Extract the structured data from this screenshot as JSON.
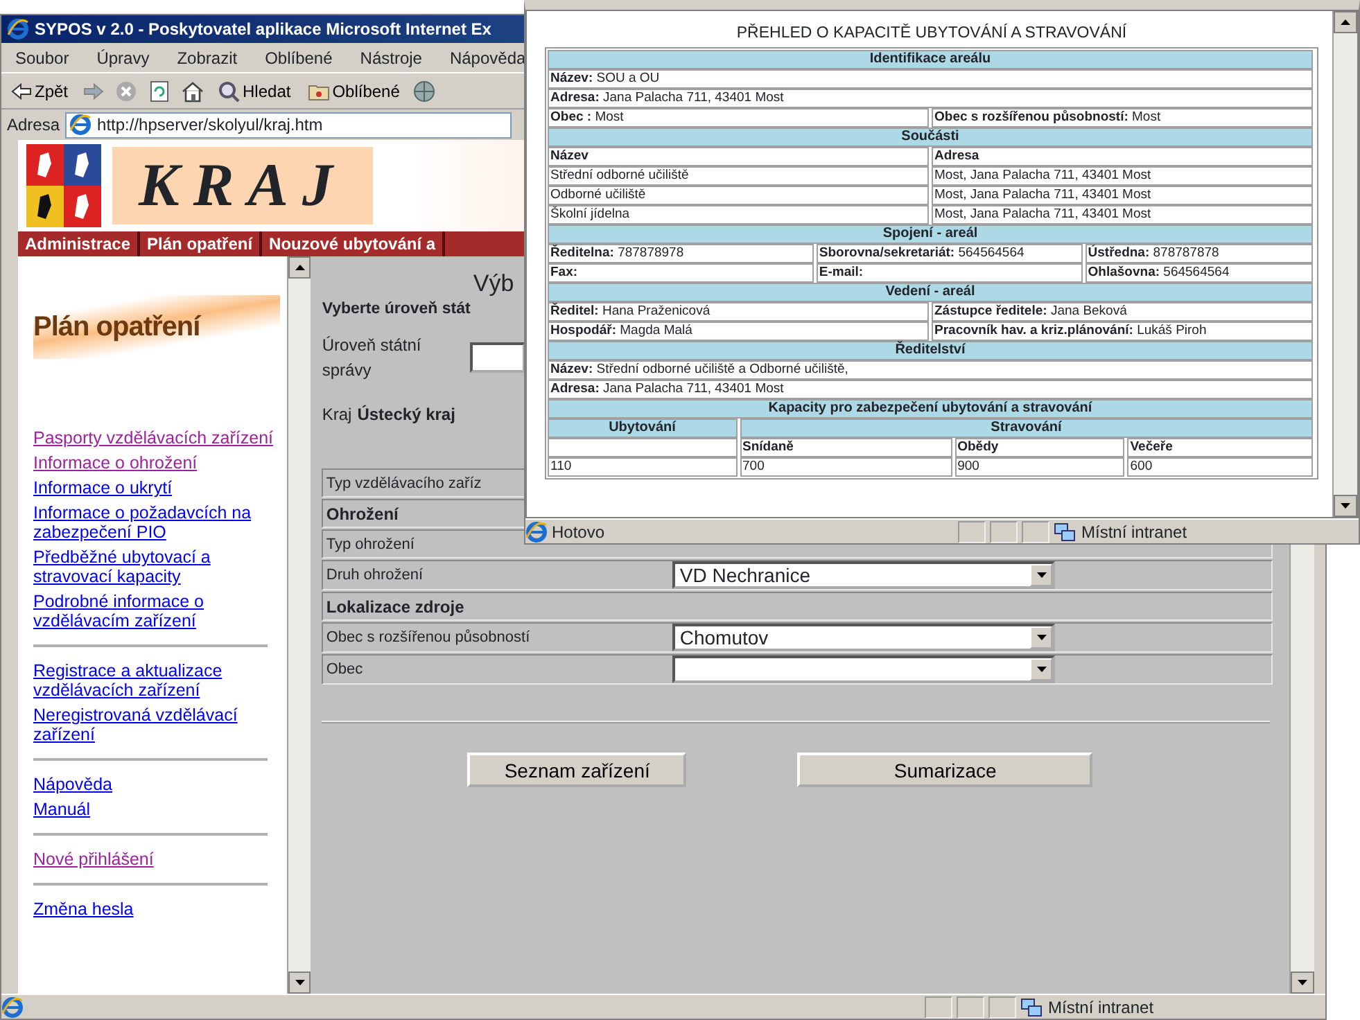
{
  "main_window": {
    "title": "SYPOS v 2.0 - Poskytovatel aplikace Microsoft Internet Ex",
    "menu": [
      "Soubor",
      "Úpravy",
      "Zobrazit",
      "Oblíbené",
      "Nástroje",
      "Nápověda"
    ],
    "toolbar": [
      {
        "kind": "back",
        "label": "Zpět"
      },
      {
        "kind": "forward"
      },
      {
        "kind": "stop"
      },
      {
        "kind": "refresh"
      },
      {
        "kind": "home"
      },
      {
        "kind": "search",
        "label": "Hledat"
      },
      {
        "kind": "favorites",
        "label": "Oblíbené"
      },
      {
        "kind": "media"
      }
    ],
    "address": {
      "label": "Adresa",
      "url": "http://hpserver/skolyul/kraj.htm"
    },
    "page": {
      "banner": {
        "title": "KRAJ"
      },
      "nav": [
        "Administrace",
        "Plán opatření",
        "Nouzové ubytování a"
      ],
      "sidebar": {
        "heading": "Plán opatření",
        "groups": [
          {
            "links": [
              {
                "label": "Pasporty vzdělávacích zařízení",
                "visited": true
              },
              {
                "label": "Informace o ohrožení",
                "visited": true
              },
              {
                "label": "Informace o ukrytí",
                "visited": false
              },
              {
                "label": "Informace o požadavcích na zabezpečení PIO",
                "visited": false
              },
              {
                "label": "Předběžné ubytovací a stravovací kapacity",
                "visited": false
              },
              {
                "label": "Podrobné informace o vzdělávacím zařízení",
                "visited": false
              }
            ]
          },
          {
            "links": [
              {
                "label": "Registrace a aktualizace vzdělávacích zařízení",
                "visited": false
              },
              {
                "label": "Neregistrovaná vzdělávací zařízení",
                "visited": false
              }
            ]
          },
          {
            "links": [
              {
                "label": "Nápověda",
                "visited": false
              },
              {
                "label": "Manuál",
                "visited": false
              }
            ]
          },
          {
            "links": [
              {
                "label": "Nové přihlášení",
                "visited": true
              }
            ]
          },
          {
            "links": [
              {
                "label": "Změna hesla",
                "visited": false
              }
            ]
          }
        ]
      },
      "form": {
        "heading": "Výb",
        "subheading": "Vyberte úroveň stát",
        "level_label": "Úroveň státní správy",
        "region_label": "Kraj",
        "region": "Ústecký kraj",
        "rows": [
          {
            "kind": "field",
            "label": "Typ vzdělávacího zaříz"
          },
          {
            "kind": "section",
            "label": "Ohrožení"
          },
          {
            "kind": "field",
            "label": "Typ ohrožení"
          },
          {
            "kind": "select",
            "label": "Druh ohrožení",
            "value": "VD Nechranice"
          },
          {
            "kind": "section",
            "label": "Lokalizace zdroje"
          },
          {
            "kind": "select",
            "label": "Obec s rozšířenou působností",
            "value": "Chomutov"
          },
          {
            "kind": "select",
            "label": "Obec"
          }
        ],
        "buttons": [
          "Seznam zařízení",
          "Sumarizace"
        ]
      }
    },
    "status_bar": {
      "zone": "Místní intranet"
    }
  },
  "popup": {
    "title": "PŘEHLED O KAPACITĚ UBYTOVÁNÍ A STRAVOVÁNÍ",
    "rows": [
      {
        "kind": "section",
        "cells": [
          {
            "label": "Identifikace areálu"
          }
        ]
      },
      {
        "kind": "cells",
        "cells": [
          {
            "label": "Název:",
            "value": "SOU a OU"
          }
        ]
      },
      {
        "kind": "cells",
        "cells": [
          {
            "label": "Adresa:",
            "value": "Jana Palacha 711, 43401 Most"
          }
        ]
      },
      {
        "kind": "cells",
        "cells": [
          {
            "label": "Obec :",
            "value": "Most"
          },
          {
            "label": "Obec s rozšířenou působností:",
            "value": "Most"
          }
        ]
      },
      {
        "kind": "section",
        "cells": [
          {
            "label": "Součásti"
          }
        ]
      },
      {
        "kind": "cells",
        "cells": [
          {
            "label": "Název"
          },
          {
            "label": "Adresa"
          }
        ]
      },
      {
        "kind": "cells",
        "cells": [
          {
            "value": "Střední odborné učiliště"
          },
          {
            "value": "Most, Jana Palacha 711, 43401 Most"
          }
        ]
      },
      {
        "kind": "cells",
        "cells": [
          {
            "value": "Odborné učiliště"
          },
          {
            "value": "Most, Jana Palacha 711, 43401 Most"
          }
        ]
      },
      {
        "kind": "cells",
        "cells": [
          {
            "value": "Školní jídelna"
          },
          {
            "value": "Most, Jana Palacha 711, 43401 Most"
          }
        ]
      },
      {
        "kind": "section",
        "cells": [
          {
            "label": "Spojení - areál"
          }
        ]
      },
      {
        "kind": "cells",
        "cells": [
          {
            "label": "Ředitelna:",
            "value": "787878978"
          },
          {
            "label": "Sborovna/sekretariát:",
            "value": "564564564"
          },
          {
            "label": "Ústředna:",
            "value": "878787878"
          }
        ]
      },
      {
        "kind": "cells",
        "cells": [
          {
            "label": "Fax:"
          },
          {
            "label": "E-mail:"
          },
          {
            "label": "Ohlašovna:",
            "value": "564564564"
          }
        ]
      },
      {
        "kind": "section",
        "cells": [
          {
            "label": "Vedení - areál"
          }
        ]
      },
      {
        "kind": "cells",
        "cells": [
          {
            "label": "Ředitel:",
            "value": "Hana Praženicová"
          },
          {
            "label": "Zástupce ředitele:",
            "value": "Jana Beková"
          }
        ]
      },
      {
        "kind": "cells",
        "cells": [
          {
            "label": "Hospodář:",
            "value": "Magda Malá"
          },
          {
            "label": "Pracovník hav. a kriz.plánování:",
            "value": "Lukáš Piroh"
          }
        ]
      },
      {
        "kind": "section",
        "cells": [
          {
            "label": "Ředitelství"
          }
        ]
      },
      {
        "kind": "cells",
        "cells": [
          {
            "label": "Název:",
            "value": "Střední odborné učiliště a Odborné učiliště,"
          }
        ]
      },
      {
        "kind": "cells",
        "cells": [
          {
            "label": "Adresa:",
            "value": "Jana Palacha 711, 43401 Most"
          }
        ]
      },
      {
        "kind": "section",
        "cells": [
          {
            "label": "Kapacity pro zabezpečení ubytování a stravování"
          }
        ]
      },
      {
        "kind": "section",
        "cells": [
          {
            "label": "Ubytování"
          },
          {
            "label": "Stravování"
          }
        ]
      },
      {
        "kind": "cells",
        "cells": [
          {},
          {
            "label": "Snídaně"
          },
          {
            "label": "Obědy"
          },
          {
            "label": "Večeře"
          }
        ]
      },
      {
        "kind": "cells",
        "cells": [
          {
            "value": "110"
          },
          {
            "value": "700"
          },
          {
            "value": "900"
          },
          {
            "value": "600"
          }
        ]
      }
    ],
    "status_bar": {
      "text": "Hotovo",
      "zone": "Místní intranet"
    }
  }
}
